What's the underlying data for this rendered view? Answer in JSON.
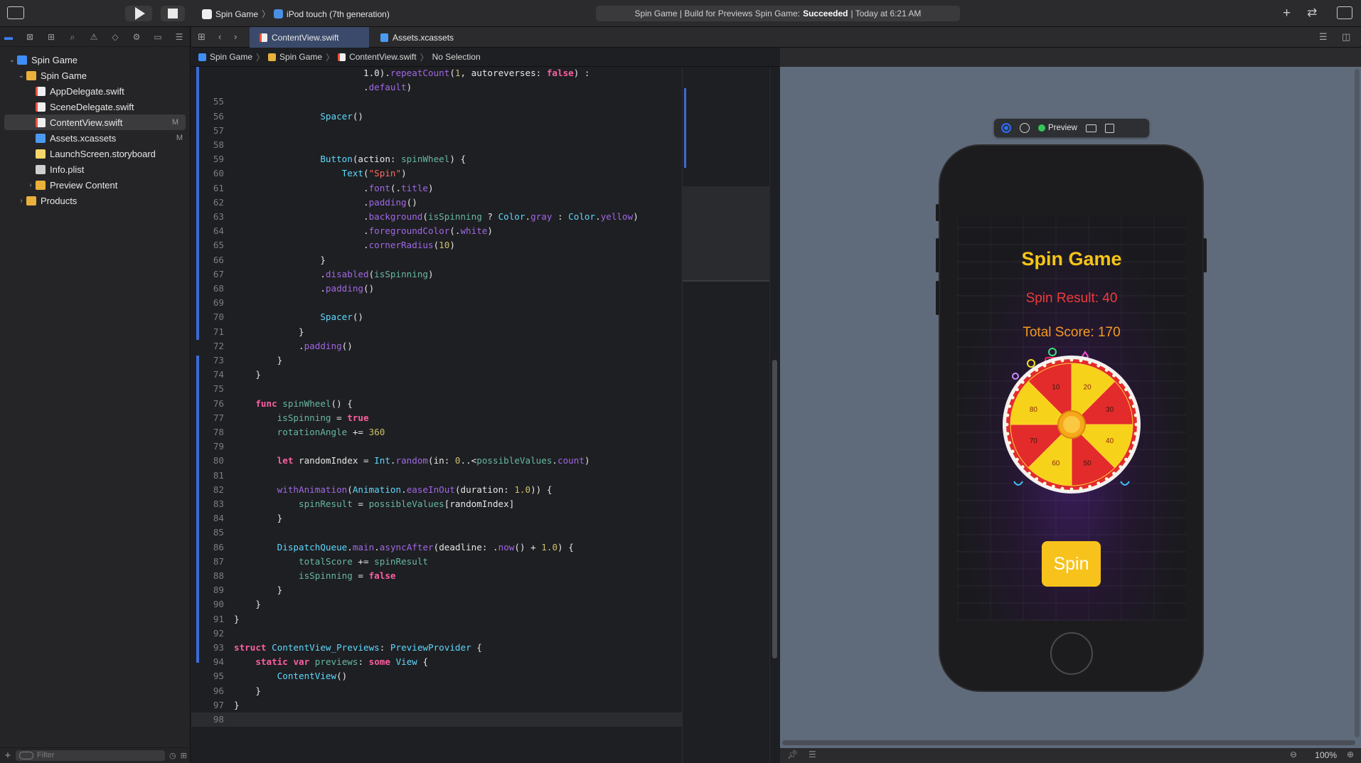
{
  "toolbar": {
    "scheme": "Spin Game",
    "device": "iPod touch (7th generation)",
    "status_prefix": "Spin Game | Build for Previews Spin Game:",
    "status_result": "Succeeded",
    "status_suffix": "| Today at 6:21 AM",
    "icons": [
      "sidebar-toggle-icon",
      "run-icon",
      "stop-icon",
      "add-icon",
      "swap-icon",
      "inspector-toggle-icon"
    ]
  },
  "navigator": {
    "items": [
      {
        "label": "Spin Game",
        "icon": "project",
        "indent": 0,
        "disclosure": "open",
        "badge": ""
      },
      {
        "label": "Spin Game",
        "icon": "folder",
        "indent": 1,
        "disclosure": "open",
        "badge": ""
      },
      {
        "label": "AppDelegate.swift",
        "icon": "swift",
        "indent": 2,
        "disclosure": "",
        "badge": ""
      },
      {
        "label": "SceneDelegate.swift",
        "icon": "swift",
        "indent": 2,
        "disclosure": "",
        "badge": ""
      },
      {
        "label": "ContentView.swift",
        "icon": "swift",
        "indent": 2,
        "disclosure": "",
        "badge": "M",
        "selected": true
      },
      {
        "label": "Assets.xcassets",
        "icon": "assets",
        "indent": 2,
        "disclosure": "",
        "badge": "M"
      },
      {
        "label": "LaunchScreen.storyboard",
        "icon": "storyboard",
        "indent": 2,
        "disclosure": "",
        "badge": ""
      },
      {
        "label": "Info.plist",
        "icon": "plist",
        "indent": 2,
        "disclosure": "",
        "badge": ""
      },
      {
        "label": "Preview Content",
        "icon": "folder",
        "indent": 2,
        "disclosure": "closed",
        "badge": ""
      },
      {
        "label": "Products",
        "icon": "folder",
        "indent": 1,
        "disclosure": "closed",
        "badge": ""
      }
    ],
    "filter_placeholder": "Filter"
  },
  "editor_tabs": [
    {
      "label": "ContentView.swift",
      "active": true
    },
    {
      "label": "Assets.xcassets",
      "active": false
    }
  ],
  "jumpbar": {
    "items": [
      "Spin Game",
      "Spin Game",
      "ContentView.swift",
      "No Selection"
    ]
  },
  "code": [
    {
      "n": "",
      "html": "                        <span class='pl'>1.0</span>).<span class='mt'>repeatCount</span>(<span class='nm'>1</span>, autoreverses: <span class='kw'>false</span>) :"
    },
    {
      "n": "",
      "html": "                        .<span class='mt'>default</span>)"
    },
    {
      "n": "55",
      "html": ""
    },
    {
      "n": "56",
      "html": "                <span class='ty'>Spacer</span>()"
    },
    {
      "n": "57",
      "html": ""
    },
    {
      "n": "58",
      "html": ""
    },
    {
      "n": "59",
      "html": "                <span class='ty'>Button</span>(action: <span class='id'>spinWheel</span>) {"
    },
    {
      "n": "60",
      "html": "                    <span class='ty'>Text</span>(<span class='st'>\"Spin\"</span>)"
    },
    {
      "n": "61",
      "html": "                        .<span class='mt'>font</span>(.<span class='mt'>title</span>)"
    },
    {
      "n": "62",
      "html": "                        .<span class='mt'>padding</span>()"
    },
    {
      "n": "63",
      "html": "                        .<span class='mt'>background</span>(<span class='id'>isSpinning</span> ? <span class='ty'>Color</span>.<span class='mt'>gray</span> : <span class='ty'>Color</span>.<span class='mt'>yellow</span>)"
    },
    {
      "n": "64",
      "html": "                        .<span class='mt'>foregroundColor</span>(.<span class='mt'>white</span>)"
    },
    {
      "n": "65",
      "html": "                        .<span class='mt'>cornerRadius</span>(<span class='nm'>10</span>)"
    },
    {
      "n": "66",
      "html": "                }"
    },
    {
      "n": "67",
      "html": "                .<span class='mt'>disabled</span>(<span class='id'>isSpinning</span>)"
    },
    {
      "n": "68",
      "html": "                .<span class='mt'>padding</span>()"
    },
    {
      "n": "69",
      "html": ""
    },
    {
      "n": "70",
      "html": "                <span class='ty'>Spacer</span>()"
    },
    {
      "n": "71",
      "html": "            }"
    },
    {
      "n": "72",
      "html": "            .<span class='mt'>padding</span>()"
    },
    {
      "n": "73",
      "html": "        }"
    },
    {
      "n": "74",
      "html": "    }"
    },
    {
      "n": "75",
      "html": ""
    },
    {
      "n": "76",
      "html": "    <span class='kw'>func</span> <span class='fn'>spinWheel</span>() {"
    },
    {
      "n": "77",
      "html": "        <span class='id'>isSpinning</span> = <span class='kw'>true</span>"
    },
    {
      "n": "78",
      "html": "        <span class='id'>rotationAngle</span> += <span class='nm'>360</span>"
    },
    {
      "n": "79",
      "html": ""
    },
    {
      "n": "80",
      "html": "        <span class='kw'>let</span> randomIndex = <span class='ty'>Int</span>.<span class='mt'>random</span>(in: <span class='nm'>0</span>..&lt;<span class='id'>possibleValues</span>.<span class='mt'>count</span>)"
    },
    {
      "n": "81",
      "html": ""
    },
    {
      "n": "82",
      "html": "        <span class='mt'>withAnimation</span>(<span class='ty'>Animation</span>.<span class='mt'>easeInOut</span>(duration: <span class='nm'>1.0</span>)) {"
    },
    {
      "n": "83",
      "html": "            <span class='id'>spinResult</span> = <span class='id'>possibleValues</span>[randomIndex]"
    },
    {
      "n": "84",
      "html": "        }"
    },
    {
      "n": "85",
      "html": ""
    },
    {
      "n": "86",
      "html": "        <span class='ty'>DispatchQueue</span>.<span class='mt'>main</span>.<span class='mt'>asyncAfter</span>(deadline: .<span class='mt'>now</span>() + <span class='nm'>1.0</span>) {"
    },
    {
      "n": "87",
      "html": "            <span class='id'>totalScore</span> += <span class='id'>spinResult</span>"
    },
    {
      "n": "88",
      "html": "            <span class='id'>isSpinning</span> = <span class='kw'>false</span>"
    },
    {
      "n": "89",
      "html": "        }"
    },
    {
      "n": "90",
      "html": "    }"
    },
    {
      "n": "91",
      "html": "}"
    },
    {
      "n": "92",
      "html": ""
    },
    {
      "n": "93",
      "html": "<span class='kw'>struct</span> <span class='ty'>ContentView_Previews</span>: <span class='ty'>PreviewProvider</span> {"
    },
    {
      "n": "94",
      "html": "    <span class='kw'>static</span> <span class='kw'>var</span> <span class='fn'>previews</span>: <span class='kw'>some</span> <span class='ty'>View</span> {"
    },
    {
      "n": "95",
      "html": "        <span class='ty'>ContentView</span>()"
    },
    {
      "n": "96",
      "html": "    }"
    },
    {
      "n": "97",
      "html": "}"
    },
    {
      "n": "98",
      "html": ""
    }
  ],
  "preview_bar": {
    "label": "Preview"
  },
  "app_preview": {
    "title": "Spin Game",
    "spin_result": "Spin Result: 40",
    "total_score": "Total Score: 170",
    "button_label": "Spin",
    "wheel_values": [
      "20",
      "30",
      "40",
      "50",
      "60",
      "70",
      "80",
      "10"
    ],
    "colors": {
      "title": "#f5c518",
      "spin_result": "#ee3b3b",
      "total_score": "#f59a23",
      "button": "#f7c21b",
      "wheel_red": "#e32b2b",
      "wheel_yellow": "#f7d21a"
    }
  },
  "canvas_footer": {
    "zoom": "100%"
  }
}
